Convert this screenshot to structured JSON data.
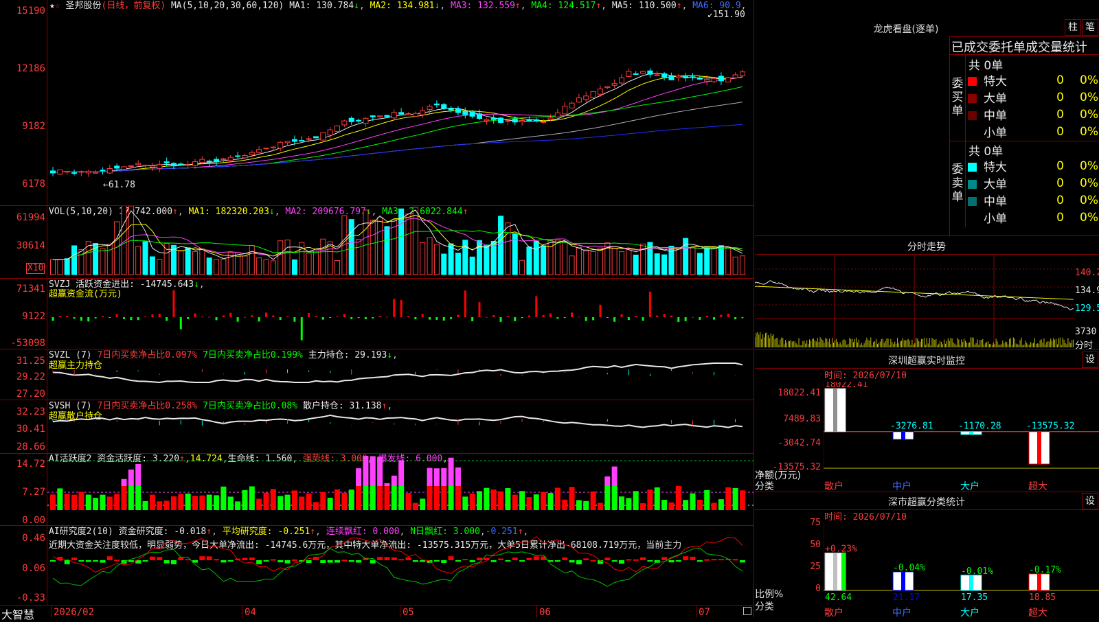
{
  "main_chart": {
    "stock_name": "圣邦股份",
    "period": "(日线，前复权)",
    "ma_params": "MA(5,10,20,30,60,120)",
    "ma": [
      {
        "label": "MA1:",
        "value": "130.784",
        "arrow": "↓",
        "color": "#e8e8e8"
      },
      {
        "label": "MA2:",
        "value": "134.981",
        "arrow": "↓",
        "color": "#ffff00"
      },
      {
        "label": "MA3:",
        "value": "132.559",
        "arrow": "↑",
        "color": "#ff40ff"
      },
      {
        "label": "MA4:",
        "value": "124.517",
        "arrow": "↑",
        "color": "#00ff00"
      },
      {
        "label": "MA5:",
        "value": "110.500",
        "arrow": "↑",
        "color": "#e8e8e8"
      },
      {
        "label": "MA6:",
        "value": "90.9",
        "arrow": "",
        "color": "#3c6cff"
      }
    ],
    "y_labels": [
      "15190",
      "12186",
      "9182",
      "6178"
    ],
    "high_label": "151.90",
    "low_label": "61.78"
  },
  "vol": {
    "label": "VOL(5,10,20)",
    "value": "179742.000",
    "ma1": "MA1: 182320.203",
    "ma2": "MA2: 209676.797",
    "ma3": "MA3: 216022.844",
    "y_labels": [
      "61994",
      "30614"
    ],
    "unit": "X10"
  },
  "svzj": {
    "label": "SVZJ  活跃资金进出: -14745.643",
    "sub": "超赢资金流(万元)",
    "y_labels": [
      "71341",
      "9122",
      "-53098"
    ]
  },
  "svzl": {
    "label": "SVZL (7)",
    "p1": "7日内买卖净占比0.097%",
    "p2": "7日内买卖净占比0.199%",
    "p3": "主力持仓: 29.193",
    "sub": "超赢主力持仓",
    "y_labels": [
      "31.25",
      "29.22",
      "27.20"
    ]
  },
  "svsh": {
    "label": "SVSH (7)",
    "p1": "7日内买卖净占比0.258%",
    "p2": "7日内买卖净占比0.08%",
    "p3": "散户持仓: 31.138",
    "sub": "超赢散户持仓",
    "y_labels": [
      "32.23",
      "30.41",
      "28.66"
    ]
  },
  "ai_active": {
    "label": "AI活跃度2 资金活跃度: 3.220",
    "v2": "14.724",
    "v3": "生命线: 1.560",
    "v4": "强势线: 3.000",
    "v5": "爆发线: 6.000",
    "y_labels": [
      "14.72",
      "7.27",
      "0.00"
    ]
  },
  "ai_research": {
    "label": "AI研究度2(10) 资金研究度: -0.018",
    "v2": "平均研究度: -0.251",
    "v3": "连续飘红: 0.000",
    "v4": "N日飘红: 3.000",
    "v5": "-0.251",
    "comment": "近期大资金关注度较低，明显弱势，今日大单净流出: -14745.6万元，其中特大单净流出: -13575.315万元，大单5日累计净出-68108.719万元，当前主力",
    "y_labels": [
      "0.46",
      "0.06",
      "-0.33"
    ]
  },
  "x_axis": {
    "brand": "大智慧",
    "labels": [
      "2026/02",
      "04",
      "05",
      "06",
      "07"
    ]
  },
  "right_panel": {
    "lhb_title": "龙虎看盘(逐单)",
    "btn_bar": "柱",
    "btn_stroke": "笔",
    "order_header": "已成交委托单成交量统计",
    "buy_group": {
      "side": "委买单",
      "total": "共 0单",
      "rows": [
        {
          "name": "特大",
          "count": "0",
          "pct": "0%",
          "color": "#ff0000"
        },
        {
          "name": "大单",
          "count": "0",
          "pct": "0%",
          "color": "#8b0000"
        },
        {
          "name": "中单",
          "count": "0",
          "pct": "0%",
          "color": "#6b0000"
        },
        {
          "name": "小单",
          "count": "0",
          "pct": "0%",
          "color": "#000000"
        }
      ]
    },
    "sell_group": {
      "side": "委卖单",
      "total": "共 0单",
      "rows": [
        {
          "name": "特大",
          "count": "0",
          "pct": "0%",
          "color": "#00ffff"
        },
        {
          "name": "大单",
          "count": "0",
          "pct": "0%",
          "color": "#008b8b"
        },
        {
          "name": "中单",
          "count": "0",
          "pct": "0%",
          "color": "#007070"
        },
        {
          "name": "小单",
          "count": "0",
          "pct": "0%",
          "color": "#000000"
        }
      ]
    },
    "intraday_title": "分时走势",
    "intraday_y": [
      "140.2",
      "134.9",
      "129.5",
      "3730"
    ],
    "intraday_unit": "分时",
    "sz_title": "深圳超赢实时监控",
    "sz_time": "时间: 2026/07/10",
    "sz_set": "设",
    "sz_y": [
      "18022.41",
      "7489.83",
      "-3042.74",
      "-13575.32"
    ],
    "sz_unit": "净额(万元)",
    "sz_cat": "分类",
    "sz_cats": [
      "散户",
      "中户",
      "大户",
      "超大"
    ],
    "sz_values": [
      "18022.41",
      "-3276.81",
      "-1170.28",
      "-13575.32"
    ],
    "sc_title": "深市超赢分类统计",
    "sc_time": "时间: 2026/07/10",
    "sc_set": "设",
    "sc_y": [
      "75",
      "50",
      "25",
      "0"
    ],
    "sc_unit": "比例%",
    "sc_cat": "分类",
    "sc_cats": [
      "散户",
      "中户",
      "大户",
      "超大"
    ],
    "sc_changes": [
      "+0.23%",
      "-0.04%",
      "-0.01%",
      "-0.17%"
    ],
    "sc_values": [
      "42.64",
      "21.17",
      "17.35",
      "18.85"
    ]
  }
}
